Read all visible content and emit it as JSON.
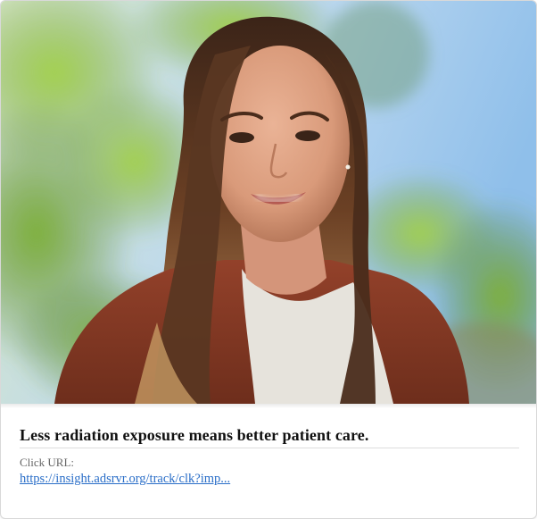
{
  "ad": {
    "headline": "Less radiation exposure means better patient care.",
    "click_url_label": "Click URL:",
    "click_url": "https://insight.adsrvr.org/track/clk?imp...",
    "image": {
      "subject": "smiling-woman-portrait",
      "colors": {
        "sky": "#9fc8ec",
        "foliage": "#8bbf45",
        "hair": "#5a3722",
        "skin": "#e2a98a",
        "cardigan": "#8a3c25",
        "shirt": "#e6e3dc"
      }
    },
    "colors": {
      "link": "#2a6ec8",
      "headline": "#111111",
      "label": "#666666",
      "border": "#d9d9d9"
    }
  }
}
